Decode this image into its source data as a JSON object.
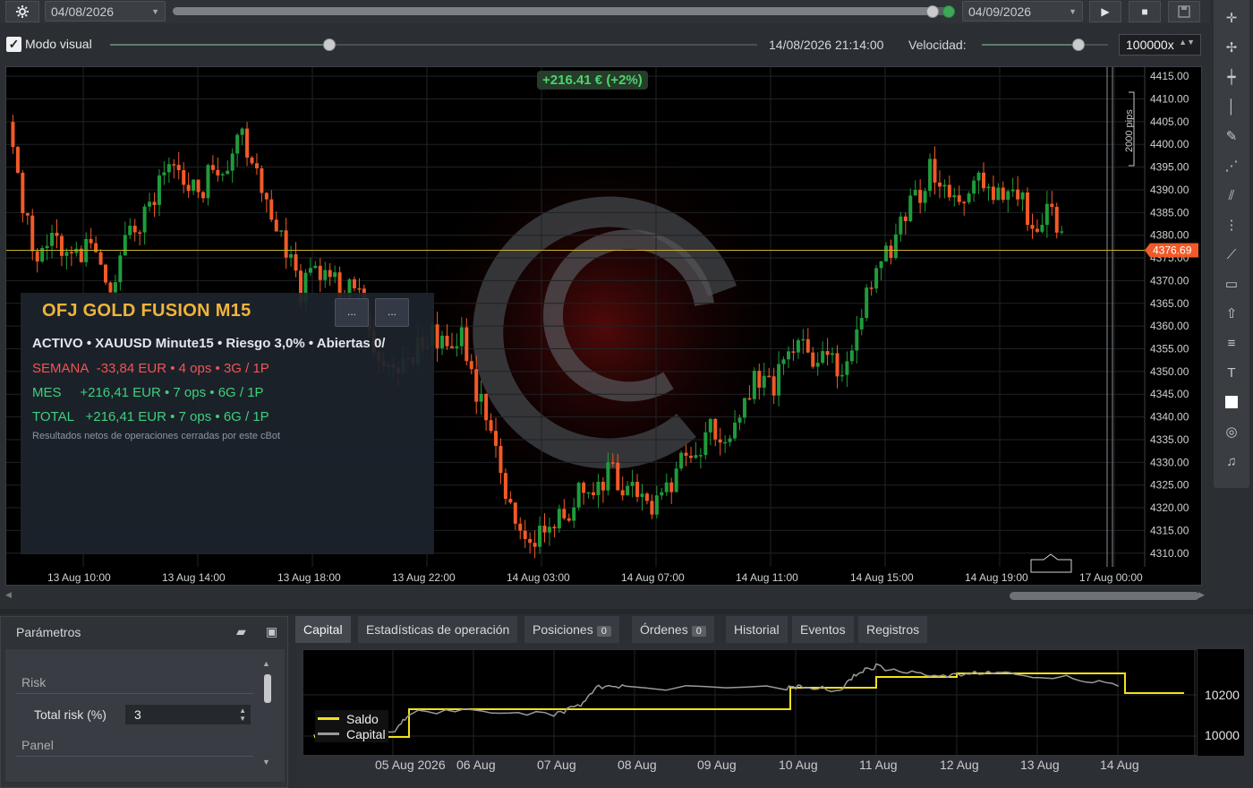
{
  "toolbar": {
    "start_date": "04/08/2026",
    "end_date": "04/09/2026",
    "modo_visual_label": "Modo visual",
    "modo_visual_checked": true,
    "current_datetime": "14/08/2026 21:14:00",
    "velocidad_label": "Velocidad:",
    "speed_value": "100000x"
  },
  "chart": {
    "profit_badge": "+216.41 € (+2%)",
    "current_price": "4376.69",
    "ruler_label": "2000 pips",
    "colors": {
      "bull": "#1f9b3b",
      "bear": "#f05a28",
      "price_line": "#c9b22a",
      "price_tag": "#f05a28"
    }
  },
  "overlay": {
    "title": "OFJ GOLD FUSION M15",
    "btn1": "...",
    "btn2": "...",
    "line_activo": "ACTIVO  •  XAUUSD Minute15  •  Riesgo 3,0%  •  Abiertas 0/",
    "semana_label": "SEMANA",
    "semana_stats": "-33,84 EUR  •  4 ops  •  3G / 1P",
    "mes_label": "MES",
    "mes_stats": "+216,41 EUR  •  7 ops  •  6G / 1P",
    "total_label": "TOTAL",
    "total_stats": "+216,41 EUR  •  7 ops  •  6G / 1P",
    "note": "Resultados netos de operaciones cerradas por este cBot"
  },
  "chart_data": {
    "type": "candlestick",
    "symbol": "XAUUSD Minute15",
    "y_ticks": [
      "4415.00",
      "4410.00",
      "4405.00",
      "4400.00",
      "4395.00",
      "4390.00",
      "4385.00",
      "4380.00",
      "4375.00",
      "4370.00",
      "4365.00",
      "4360.00",
      "4355.00",
      "4350.00",
      "4345.00",
      "4340.00",
      "4335.00",
      "4330.00",
      "4325.00",
      "4320.00",
      "4315.00",
      "4310.00"
    ],
    "ylim": [
      4307,
      4417
    ],
    "x_labels": [
      "13 Aug 10:00",
      "13 Aug 14:00",
      "13 Aug 18:00",
      "13 Aug 22:00",
      "14 Aug 03:00",
      "14 Aug 07:00",
      "14 Aug 11:00",
      "14 Aug 15:00",
      "14 Aug 19:00",
      "17 Aug 00:00"
    ],
    "current_price": 4376.69,
    "close_path": [
      4405,
      4385,
      4375,
      4381,
      4374,
      4377,
      4379,
      4369,
      4378,
      4383,
      4388,
      4395,
      4392,
      4388,
      4397,
      4394,
      4404,
      4392,
      4384,
      4378,
      4368,
      4372,
      4372,
      4366,
      4370,
      4357,
      4350,
      4352,
      4355,
      4358,
      4354,
      4358,
      4345,
      4338,
      4323,
      4315,
      4314,
      4317,
      4318,
      4324,
      4323,
      4328,
      4325,
      4322,
      4319,
      4323,
      4333,
      4329,
      4337,
      4334,
      4342,
      4348,
      4346,
      4351,
      4357,
      4352,
      4353,
      4349,
      4360,
      4369,
      4376,
      4382,
      4388,
      4394,
      4391,
      4386,
      4390,
      4393,
      4386,
      4390,
      4382,
      4385,
      4380,
      4378,
      4374
    ]
  },
  "params": {
    "title": "Parámetros",
    "section_risk": "Risk",
    "total_risk_label": "Total risk (%)",
    "total_risk_value": "3",
    "section_panel": "Panel"
  },
  "tabs": [
    {
      "label": "Capital"
    },
    {
      "label": "Estadísticas de operación"
    },
    {
      "label": "Posiciones",
      "badge": "0"
    },
    {
      "label": "Órdenes",
      "badge": "0"
    },
    {
      "label": "Historial"
    },
    {
      "label": "Eventos"
    },
    {
      "label": "Registros"
    }
  ],
  "capital_chart": {
    "type": "line",
    "x_labels": [
      "05 Aug 2026",
      "06 Aug",
      "07 Aug",
      "08 Aug",
      "09 Aug",
      "10 Aug",
      "11 Aug",
      "12 Aug",
      "13 Aug",
      "14 Aug"
    ],
    "y_ticks": [
      "10200",
      "10000"
    ],
    "series": [
      {
        "name": "Saldo",
        "color": "#f2e21a"
      },
      {
        "name": "Capital",
        "color": "#9a9a9a"
      }
    ]
  }
}
